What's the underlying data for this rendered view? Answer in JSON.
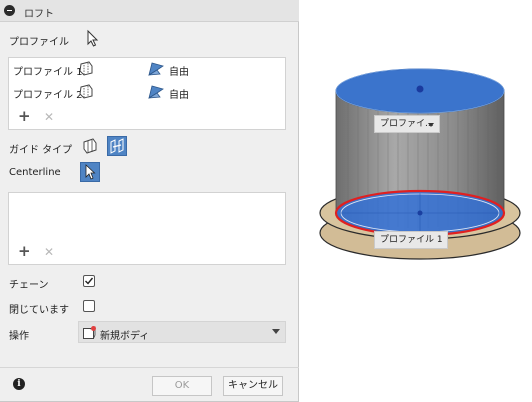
{
  "dialog": {
    "title": "ロフト",
    "profiles_label": "プロファイル",
    "profiles": [
      {
        "name": "プロファイル 1",
        "condition": "自由"
      },
      {
        "name": "プロファイル 2",
        "condition": "自由"
      }
    ],
    "guide_type_label": "ガイド タイプ",
    "centerline_label": "Centerline",
    "chain_label": "チェーン",
    "chain_checked": true,
    "closed_label": "閉じています",
    "closed_checked": false,
    "operation_label": "操作",
    "operation_value": "新規ボディ",
    "ok_label": "OK",
    "cancel_label": "キャンセル"
  },
  "viewport": {
    "top_tag": "プロファイ...",
    "bottom_tag": "プロファイル 1"
  },
  "colors": {
    "accent": "#4f84c4",
    "profile_fill": "#2f6fd8",
    "body_gray": "#9a9a9a",
    "plane": "#d2bc96",
    "selection_red": "#e02020"
  }
}
